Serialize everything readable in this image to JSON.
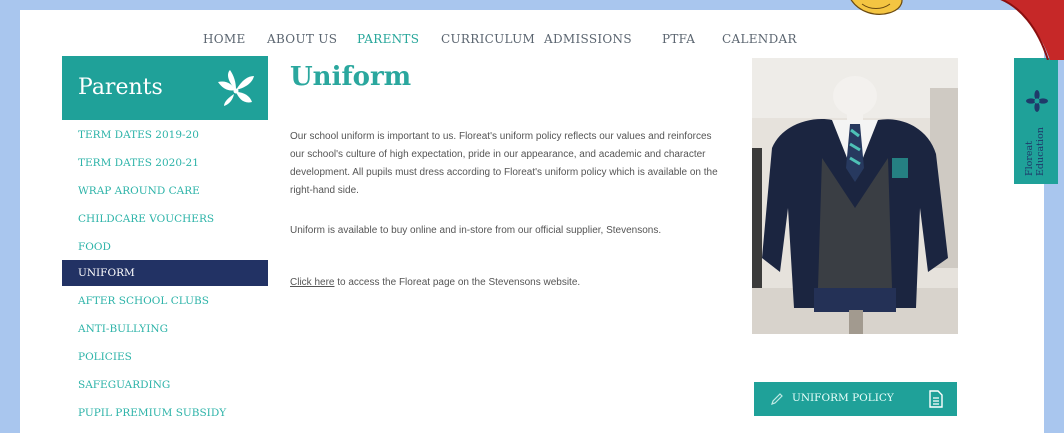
{
  "nav": {
    "items": [
      {
        "label": "HOME",
        "active": false
      },
      {
        "label": "ABOUT US",
        "active": false
      },
      {
        "label": "PARENTS",
        "active": true
      },
      {
        "label": "CURRICULUM",
        "active": false
      },
      {
        "label": "ADMISSIONS",
        "active": false
      },
      {
        "label": "PTFA",
        "active": false
      },
      {
        "label": "CALENDAR",
        "active": false
      }
    ]
  },
  "sidebar": {
    "title": "Parents",
    "icon": "leaf-logo-icon",
    "items": [
      {
        "label": "TERM DATES 2019-20",
        "active": false
      },
      {
        "label": "TERM DATES 2020-21",
        "active": false
      },
      {
        "label": "WRAP AROUND CARE",
        "active": false
      },
      {
        "label": "CHILDCARE VOUCHERS",
        "active": false
      },
      {
        "label": "FOOD",
        "active": false
      },
      {
        "label": "UNIFORM",
        "active": true
      },
      {
        "label": "AFTER SCHOOL CLUBS",
        "active": false
      },
      {
        "label": "ANTI-BULLYING",
        "active": false
      },
      {
        "label": "POLICIES",
        "active": false
      },
      {
        "label": "SAFEGUARDING",
        "active": false
      },
      {
        "label": "PUPIL PREMIUM SUBSIDY",
        "active": false
      }
    ]
  },
  "main": {
    "title": "Uniform",
    "paragraph_1": "Our school uniform is important to us. Floreat's uniform policy reflects our values and reinforces our school's culture of high expectation, pride in our appearance, and academic and character development. All pupils must dress according to Floreat's uniform policy which is available on the right-hand side.",
    "paragraph_2": "Uniform is available to buy online and in-store from our official supplier, Stevensons.",
    "link_text": "Click here",
    "paragraph_3_rest": " to access the Floreat page on the Stevensons website."
  },
  "aside": {
    "policy_button_label": "UNIFORM POLICY",
    "policy_icon": "document-icon"
  },
  "brand_tab": {
    "line1": "Floreat",
    "line2": "Education"
  },
  "colors": {
    "accent": "#1fa199",
    "active_nav": "#26a69a",
    "sidebar_active": "#223264",
    "frame_blue": "#a9c6ee"
  }
}
